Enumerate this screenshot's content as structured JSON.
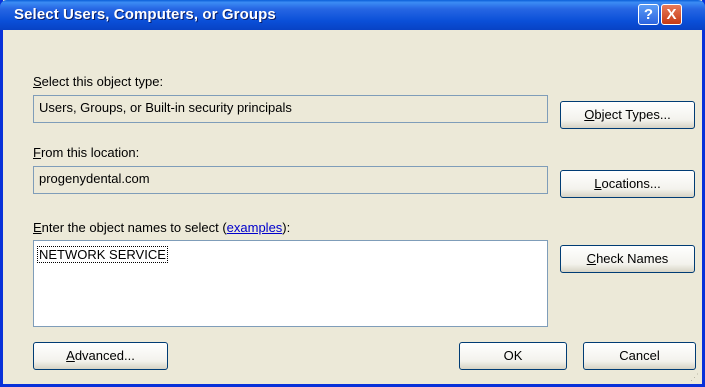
{
  "dialog": {
    "title": "Select Users, Computers, or Groups",
    "help_icon": "?",
    "close_icon": "X"
  },
  "object_type": {
    "label_accel": "S",
    "label_rest": "elect this object type:",
    "value": "Users, Groups, or Built-in security principals",
    "button_accel": "O",
    "button_rest": "bject Types..."
  },
  "location": {
    "label_accel": "F",
    "label_rest": "rom this location:",
    "value": "progenydental.com",
    "button_accel": "L",
    "button_rest": "ocations..."
  },
  "names": {
    "label_accel": "E",
    "label_rest": "nter the object names to select (",
    "link_text": "examples",
    "label_end": "):",
    "value": "NETWORK SERVICE",
    "check_accel": "C",
    "check_rest": "heck Names"
  },
  "buttons": {
    "advanced_accel": "A",
    "advanced_rest": "dvanced...",
    "ok": "OK",
    "cancel": "Cancel"
  },
  "colors": {
    "titlebar": "#0a4fd8",
    "dialog_bg": "#ece9d8",
    "link": "#0000cc"
  }
}
